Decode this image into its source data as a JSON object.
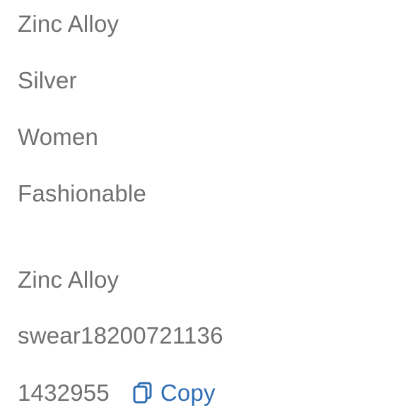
{
  "details": {
    "material": "Zinc Alloy",
    "color": "Silver",
    "gender": "Women",
    "style": "Fashionable",
    "main_material": "Zinc Alloy",
    "seller": "swear18200721136",
    "item_id": "1432955",
    "copy_label": "Copy"
  },
  "icons": {
    "copy": "copy-icon"
  },
  "colors": {
    "text": "#707070",
    "accent": "#2f6db5",
    "background": "#ffffff"
  }
}
